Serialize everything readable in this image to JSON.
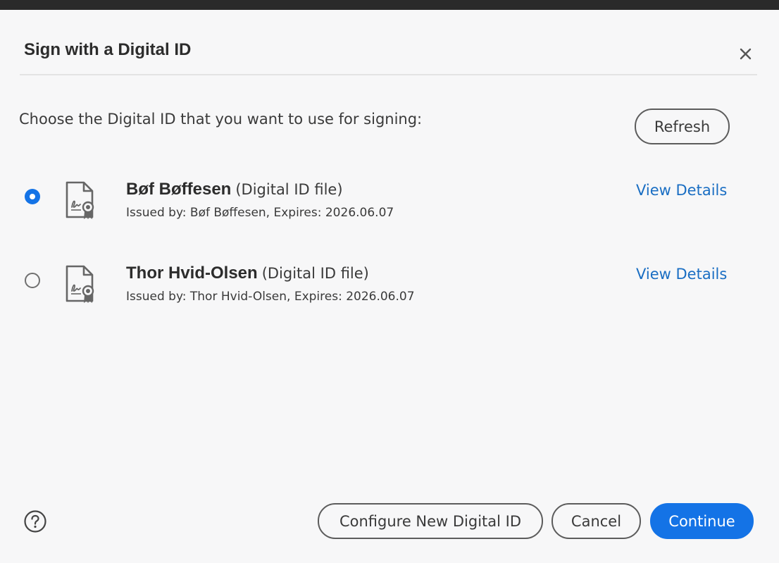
{
  "dialog": {
    "title": "Sign with a Digital ID",
    "close_icon": "close-icon",
    "prompt": "Choose the Digital ID that you want to use for signing:",
    "refresh_label": "Refresh"
  },
  "ids": [
    {
      "name": "Bøf Bøffesen",
      "type": "(Digital ID file)",
      "issued": "Issued by: Bøf Bøffesen, Expires: 2026.06.07",
      "details_label": "View Details",
      "selected": true,
      "icon": "certificate-icon"
    },
    {
      "name": "Thor Hvid-Olsen",
      "type": "(Digital ID file)",
      "issued": "Issued by: Thor Hvid-Olsen, Expires: 2026.06.07",
      "details_label": "View Details",
      "selected": false,
      "icon": "certificate-icon"
    }
  ],
  "footer": {
    "help_icon": "help-icon",
    "configure_label": "Configure New Digital ID",
    "cancel_label": "Cancel",
    "continue_label": "Continue"
  },
  "colors": {
    "accent": "#1473e6",
    "link": "#1a6ec3",
    "background": "#f7f7f8"
  }
}
